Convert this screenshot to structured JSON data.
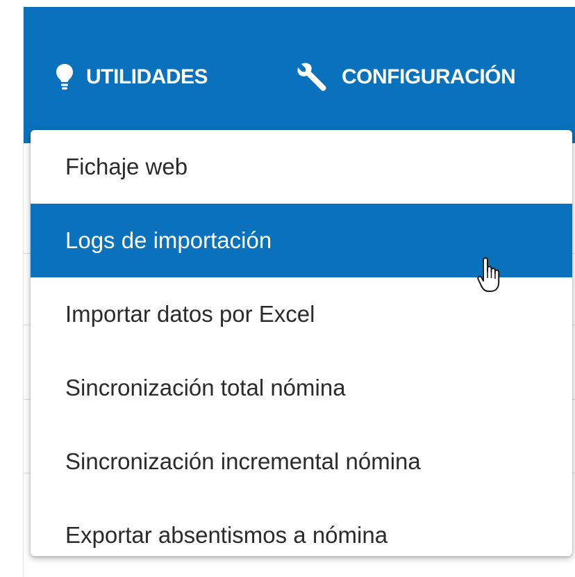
{
  "colors": {
    "accent": "#0a72bd",
    "menu_text": "#2b2b2b",
    "menu_text_active": "#ffffff"
  },
  "nav": {
    "items": [
      {
        "label": "UTILIDADES",
        "icon": "lightbulb-icon"
      },
      {
        "label": "CONFIGURACIÓN",
        "icon": "wrench-icon"
      }
    ]
  },
  "dropdown": {
    "active_item": "Logs de importación",
    "items": [
      {
        "label": "Fichaje web"
      },
      {
        "label": "Logs de importación"
      },
      {
        "label": "Importar datos por Excel"
      },
      {
        "label": "Sincronización total nómina"
      },
      {
        "label": "Sincronización incremental nómina"
      },
      {
        "label": "Exportar absentismos a nómina"
      }
    ]
  },
  "cursor": {
    "icon": "hand-pointer-icon"
  }
}
